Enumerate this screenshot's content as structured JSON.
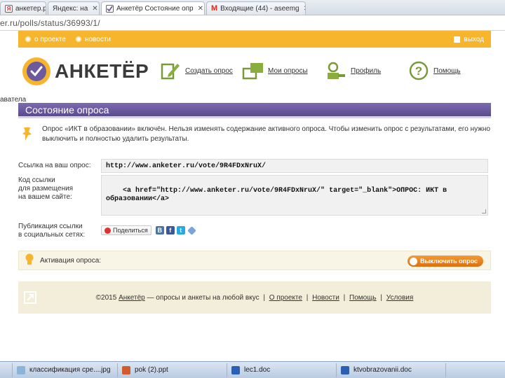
{
  "browser": {
    "tabs": [
      {
        "label": "анкетер.ру",
        "icon": "yandex-icon"
      },
      {
        "label": "Яндекс: на"
      },
      {
        "label": "Анкетёр  Состояние опр",
        "icon": "anketer-icon",
        "active": true
      },
      {
        "label": "Входящие (44) - aseemg",
        "icon": "gmail-icon"
      }
    ],
    "url": "er.ru/polls/status/36993/1/"
  },
  "topnav": {
    "items": [
      "о проекте",
      "новости"
    ],
    "logout": "выход"
  },
  "logo": {
    "text": "АНКЕТЁР"
  },
  "header_nav": [
    {
      "label": "Создать опрос",
      "icon": "pencil-icon"
    },
    {
      "label": "Мои опросы",
      "icon": "folders-icon"
    },
    {
      "label": "Профиль",
      "icon": "key-icon"
    },
    {
      "label": "Помощь",
      "icon": "question-icon"
    }
  ],
  "breadcrumb": "аватела",
  "page_title": "Состояние опроса",
  "notice": "Опрос «ИКТ в образовании» включён. Нельзя изменять содержание активного опроса. Чтобы изменить опрос с результатами, его нужно выключить и полностью удалить результаты.",
  "link": {
    "label": "Ссылка на ваш опрос:",
    "value": "http://www.anketer.ru/vote/9R4FDxNruX/"
  },
  "embed": {
    "label": "Код ссылки\nдля размещения\nна вашем сайте:",
    "value": "<a href=\"http://www.anketer.ru/vote/9R4FDxNruX/\" target=\"_blank\">ОПРОС: ИКТ в\nобразовании</a>"
  },
  "social": {
    "label": "Публикация ссылки\nв социальных сетях:",
    "share_button": "Поделиться",
    "icons": [
      "vk-icon",
      "facebook-icon",
      "twitter-icon",
      "bookmark-icon"
    ]
  },
  "activation": {
    "label": "Активация опроса:",
    "button": "Выключить опрос"
  },
  "footer": {
    "prefix": "©2015",
    "brand": "Анкетёр",
    "tagline": "— опросы и анкеты на любой вкус",
    "links": [
      "О проекте",
      "Новости",
      "Помощь",
      "Условия"
    ]
  },
  "taskbar": [
    {
      "label": "классификация сре....jpg"
    },
    {
      "label": "pok (2).ppt"
    },
    {
      "label": "lec1.doc"
    },
    {
      "label": "ktvobrazovanii.doc"
    }
  ],
  "colors": {
    "orange": "#f6b52c",
    "purple": "#6d5a9e",
    "button_orange": "#e88322"
  }
}
